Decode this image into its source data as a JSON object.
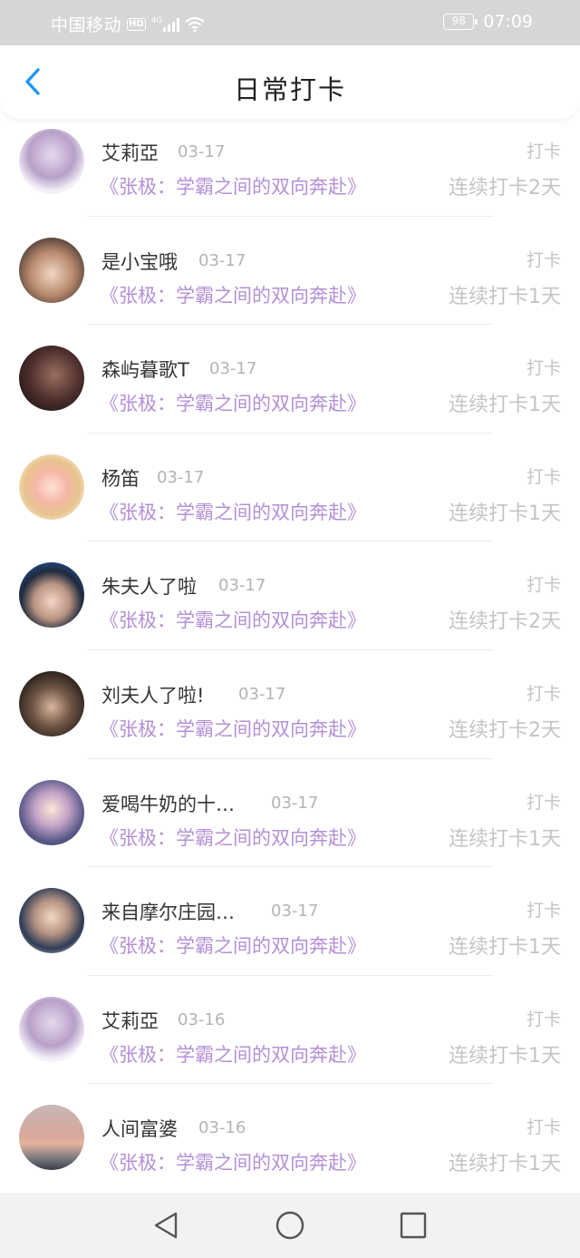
{
  "status_bar": {
    "carrier": "中国移动",
    "hd": "HD",
    "network": "4G",
    "battery": "98",
    "time": "07:09"
  },
  "header": {
    "title": "日常打卡",
    "back_icon": "chevron-left-icon",
    "accent": "#2196f3"
  },
  "colors": {
    "book_title": "#b48fd6",
    "muted": "#c4c4c4"
  },
  "entries": [
    {
      "name": "艾莉亞",
      "date": "03-17",
      "book": "《张极：学霸之间的双向奔赴》",
      "action": "打卡",
      "streak": "连续打卡2天"
    },
    {
      "name": "是小宝哦",
      "date": "03-17",
      "book": "《张极：学霸之间的双向奔赴》",
      "action": "打卡",
      "streak": "连续打卡1天"
    },
    {
      "name": "森屿暮歌T",
      "date": "03-17",
      "book": "《张极：学霸之间的双向奔赴》",
      "action": "打卡",
      "streak": "连续打卡1天"
    },
    {
      "name": "杨笛",
      "date": "03-17",
      "book": "《张极：学霸之间的双向奔赴》",
      "action": "打卡",
      "streak": "连续打卡1天"
    },
    {
      "name": "朱夫人了啦",
      "date": "03-17",
      "book": "《张极：学霸之间的双向奔赴》",
      "action": "打卡",
      "streak": "连续打卡2天"
    },
    {
      "name": "刘夫人了啦!",
      "date": "03-17",
      "book": "《张极：学霸之间的双向奔赴》",
      "action": "打卡",
      "streak": "连续打卡2天"
    },
    {
      "name": "爱喝牛奶的十…",
      "date": "03-17",
      "book": "《张极：学霸之间的双向奔赴》",
      "action": "打卡",
      "streak": "连续打卡1天"
    },
    {
      "name": "来自摩尔庄园…",
      "date": "03-17",
      "book": "《张极：学霸之间的双向奔赴》",
      "action": "打卡",
      "streak": "连续打卡1天"
    },
    {
      "name": "艾莉亞",
      "date": "03-16",
      "book": "《张极：学霸之间的双向奔赴》",
      "action": "打卡",
      "streak": "连续打卡1天"
    },
    {
      "name": "人间富婆",
      "date": "03-16",
      "book": "《张极：学霸之间的双向奔赴》",
      "action": "打卡",
      "streak": "连续打卡1天"
    }
  ],
  "nav_bar": {
    "back_icon": "triangle-back-icon",
    "home_icon": "circle-home-icon",
    "recent_icon": "square-recents-icon"
  }
}
